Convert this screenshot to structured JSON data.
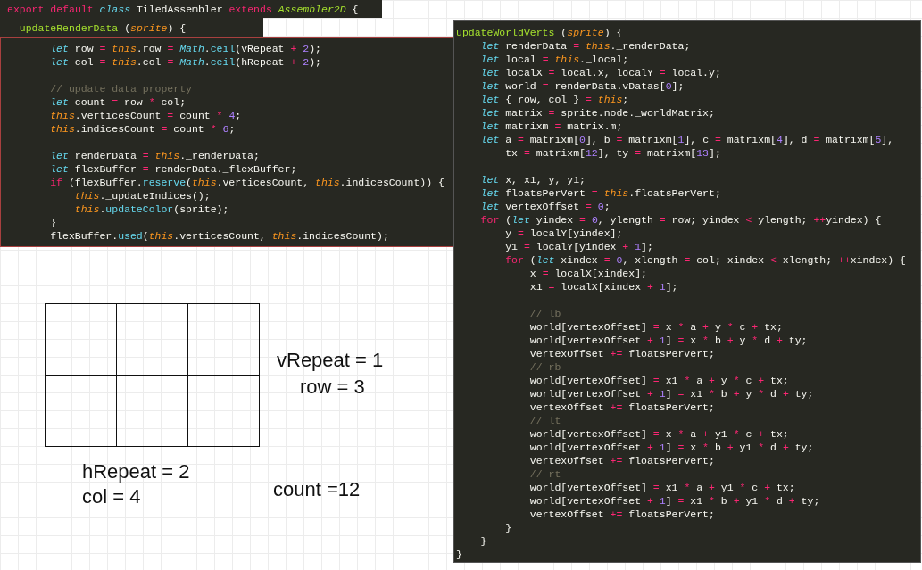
{
  "left_editor": {
    "class_line": [
      {
        "kind": "kw",
        "text": "export default "
      },
      {
        "kind": "st",
        "text": "class"
      },
      " TiledAssembler ",
      {
        "kind": "kw",
        "text": "extends "
      },
      {
        "kind": "ty",
        "text": "Assembler2D"
      },
      " {"
    ],
    "method_line": [
      {
        "kind": "fn",
        "text": "  updateRenderData"
      },
      " (",
      {
        "kind": "th",
        "text": "sprite"
      },
      ") {"
    ],
    "blocks": [
      [
        [
          {
            "kind": "st",
            "text": "        let"
          },
          " row ",
          {
            "kind": "op",
            "text": "= "
          },
          {
            "kind": "th",
            "text": "this"
          },
          ".row ",
          {
            "kind": "op",
            "text": "= "
          },
          {
            "kind": "st",
            "text": "Math"
          },
          ".",
          {
            "kind": "sp",
            "text": "ceil"
          },
          "(vRepeat ",
          {
            "kind": "op",
            "text": "+ "
          },
          {
            "kind": "nu",
            "text": "2"
          },
          ");"
        ],
        [
          {
            "kind": "st",
            "text": "        let"
          },
          " col ",
          {
            "kind": "op",
            "text": "= "
          },
          {
            "kind": "th",
            "text": "this"
          },
          ".col ",
          {
            "kind": "op",
            "text": "= "
          },
          {
            "kind": "st",
            "text": "Math"
          },
          ".",
          {
            "kind": "sp",
            "text": "ceil"
          },
          "(hRepeat ",
          {
            "kind": "op",
            "text": "+ "
          },
          {
            "kind": "nu",
            "text": "2"
          },
          ");"
        ]
      ],
      [
        [
          {
            "kind": "cm",
            "text": "        // update data property"
          }
        ],
        [
          {
            "kind": "st",
            "text": "        let"
          },
          " count ",
          {
            "kind": "op",
            "text": "= "
          },
          "row ",
          {
            "kind": "op",
            "text": "* "
          },
          "col;"
        ],
        [
          {
            "kind": "th",
            "text": "        this"
          },
          ".verticesCount ",
          {
            "kind": "op",
            "text": "= "
          },
          "count ",
          {
            "kind": "op",
            "text": "* "
          },
          {
            "kind": "nu",
            "text": "4"
          },
          ";"
        ],
        [
          {
            "kind": "th",
            "text": "        this"
          },
          ".indicesCount ",
          {
            "kind": "op",
            "text": "= "
          },
          "count ",
          {
            "kind": "op",
            "text": "* "
          },
          {
            "kind": "nu",
            "text": "6"
          },
          ";"
        ]
      ],
      [
        [
          {
            "kind": "st",
            "text": "        let"
          },
          " renderData ",
          {
            "kind": "op",
            "text": "= "
          },
          {
            "kind": "th",
            "text": "this"
          },
          "._renderData;"
        ],
        [
          {
            "kind": "st",
            "text": "        let"
          },
          " flexBuffer ",
          {
            "kind": "op",
            "text": "= "
          },
          "renderData._flexBuffer;"
        ],
        [
          {
            "kind": "kw",
            "text": "        if"
          },
          " (flexBuffer.",
          {
            "kind": "sp",
            "text": "reserve"
          },
          "(",
          {
            "kind": "th",
            "text": "this"
          },
          ".verticesCount, ",
          {
            "kind": "th",
            "text": "this"
          },
          ".indicesCount)) {"
        ],
        [
          {
            "kind": "th",
            "text": "            this"
          },
          "._updateIndices();"
        ],
        [
          {
            "kind": "th",
            "text": "            this"
          },
          ".",
          {
            "kind": "sp",
            "text": "updateColor"
          },
          "(sprite);"
        ],
        [
          "        }"
        ],
        [
          "        flexBuffer.",
          {
            "kind": "sp",
            "text": "used"
          },
          "(",
          {
            "kind": "th",
            "text": "this"
          },
          ".verticesCount, ",
          {
            "kind": "th",
            "text": "this"
          },
          ".indicesCount);"
        ]
      ]
    ]
  },
  "right_editor": {
    "blocks": [
      [
        [
          {
            "kind": "fn",
            "text": "updateWorldVerts"
          },
          " (",
          {
            "kind": "th",
            "text": "sprite"
          },
          ") {"
        ],
        [
          {
            "kind": "st",
            "text": "    let"
          },
          " renderData ",
          {
            "kind": "op",
            "text": "= "
          },
          {
            "kind": "th",
            "text": "this"
          },
          "._renderData;"
        ],
        [
          {
            "kind": "st",
            "text": "    let"
          },
          " local ",
          {
            "kind": "op",
            "text": "= "
          },
          {
            "kind": "th",
            "text": "this"
          },
          "._local;"
        ],
        [
          {
            "kind": "st",
            "text": "    let"
          },
          " localX ",
          {
            "kind": "op",
            "text": "= "
          },
          "local.x, localY ",
          {
            "kind": "op",
            "text": "= "
          },
          "local.y;"
        ],
        [
          {
            "kind": "st",
            "text": "    let"
          },
          " world ",
          {
            "kind": "op",
            "text": "= "
          },
          "renderData.vDatas[",
          {
            "kind": "nu",
            "text": "0"
          },
          "];"
        ],
        [
          {
            "kind": "st",
            "text": "    let"
          },
          " { row, col } ",
          {
            "kind": "op",
            "text": "= "
          },
          {
            "kind": "th",
            "text": "this"
          },
          ";"
        ],
        [
          {
            "kind": "st",
            "text": "    let"
          },
          " matrix ",
          {
            "kind": "op",
            "text": "= "
          },
          "sprite.node._worldMatrix;"
        ],
        [
          {
            "kind": "st",
            "text": "    let"
          },
          " matrixm ",
          {
            "kind": "op",
            "text": "= "
          },
          "matrix.m;"
        ],
        [
          {
            "kind": "st",
            "text": "    let"
          },
          " a ",
          {
            "kind": "op",
            "text": "= "
          },
          "matrixm[",
          {
            "kind": "nu",
            "text": "0"
          },
          "], b ",
          {
            "kind": "op",
            "text": "= "
          },
          "matrixm[",
          {
            "kind": "nu",
            "text": "1"
          },
          "], c ",
          {
            "kind": "op",
            "text": "= "
          },
          "matrixm[",
          {
            "kind": "nu",
            "text": "4"
          },
          "], d ",
          {
            "kind": "op",
            "text": "= "
          },
          "matrixm[",
          {
            "kind": "nu",
            "text": "5"
          },
          "],"
        ],
        [
          "        tx ",
          {
            "kind": "op",
            "text": "= "
          },
          "matrixm[",
          {
            "kind": "nu",
            "text": "12"
          },
          "], ty ",
          {
            "kind": "op",
            "text": "= "
          },
          "matrixm[",
          {
            "kind": "nu",
            "text": "13"
          },
          "];"
        ]
      ],
      [
        [
          {
            "kind": "st",
            "text": "    let"
          },
          " x, x1, y, y1;"
        ],
        [
          {
            "kind": "st",
            "text": "    let"
          },
          " floatsPerVert ",
          {
            "kind": "op",
            "text": "= "
          },
          {
            "kind": "th",
            "text": "this"
          },
          ".floatsPerVert;"
        ],
        [
          {
            "kind": "st",
            "text": "    let"
          },
          " vertexOffset ",
          {
            "kind": "op",
            "text": "= "
          },
          {
            "kind": "nu",
            "text": "0"
          },
          ";"
        ],
        [
          {
            "kind": "kw",
            "text": "    for"
          },
          " (",
          {
            "kind": "st",
            "text": "let"
          },
          " yindex ",
          {
            "kind": "op",
            "text": "= "
          },
          {
            "kind": "nu",
            "text": "0"
          },
          ", ylength ",
          {
            "kind": "op",
            "text": "= "
          },
          "row; yindex ",
          {
            "kind": "op",
            "text": "< "
          },
          "ylength; ",
          {
            "kind": "op",
            "text": "++"
          },
          "yindex) {"
        ],
        [
          "        y ",
          {
            "kind": "op",
            "text": "= "
          },
          "localY[yindex];"
        ],
        [
          "        y1 ",
          {
            "kind": "op",
            "text": "= "
          },
          "localY[yindex ",
          {
            "kind": "op",
            "text": "+ "
          },
          {
            "kind": "nu",
            "text": "1"
          },
          "];"
        ],
        [
          {
            "kind": "kw",
            "text": "        for"
          },
          " (",
          {
            "kind": "st",
            "text": "let"
          },
          " xindex ",
          {
            "kind": "op",
            "text": "= "
          },
          {
            "kind": "nu",
            "text": "0"
          },
          ", xlength ",
          {
            "kind": "op",
            "text": "= "
          },
          "col; xindex ",
          {
            "kind": "op",
            "text": "< "
          },
          "xlength; ",
          {
            "kind": "op",
            "text": "++"
          },
          "xindex) {"
        ],
        [
          "            x ",
          {
            "kind": "op",
            "text": "= "
          },
          "localX[xindex];"
        ],
        [
          "            x1 ",
          {
            "kind": "op",
            "text": "= "
          },
          "localX[xindex ",
          {
            "kind": "op",
            "text": "+ "
          },
          {
            "kind": "nu",
            "text": "1"
          },
          "];"
        ]
      ],
      [
        [
          {
            "kind": "cm",
            "text": "            // lb"
          }
        ],
        [
          "            world[vertexOffset] ",
          {
            "kind": "op",
            "text": "= "
          },
          "x ",
          {
            "kind": "op",
            "text": "* "
          },
          "a ",
          {
            "kind": "op",
            "text": "+ "
          },
          "y ",
          {
            "kind": "op",
            "text": "* "
          },
          "c ",
          {
            "kind": "op",
            "text": "+ "
          },
          "tx;"
        ],
        [
          "            world[vertexOffset ",
          {
            "kind": "op",
            "text": "+ "
          },
          {
            "kind": "nu",
            "text": "1"
          },
          "] ",
          {
            "kind": "op",
            "text": "= "
          },
          "x ",
          {
            "kind": "op",
            "text": "* "
          },
          "b ",
          {
            "kind": "op",
            "text": "+ "
          },
          "y ",
          {
            "kind": "op",
            "text": "* "
          },
          "d ",
          {
            "kind": "op",
            "text": "+ "
          },
          "ty;"
        ],
        [
          "            vertexOffset ",
          {
            "kind": "op",
            "text": "+= "
          },
          "floatsPerVert;"
        ],
        [
          {
            "kind": "cm",
            "text": "            // rb"
          }
        ],
        [
          "            world[vertexOffset] ",
          {
            "kind": "op",
            "text": "= "
          },
          "x1 ",
          {
            "kind": "op",
            "text": "* "
          },
          "a ",
          {
            "kind": "op",
            "text": "+ "
          },
          "y ",
          {
            "kind": "op",
            "text": "* "
          },
          "c ",
          {
            "kind": "op",
            "text": "+ "
          },
          "tx;"
        ],
        [
          "            world[vertexOffset ",
          {
            "kind": "op",
            "text": "+ "
          },
          {
            "kind": "nu",
            "text": "1"
          },
          "] ",
          {
            "kind": "op",
            "text": "= "
          },
          "x1 ",
          {
            "kind": "op",
            "text": "* "
          },
          "b ",
          {
            "kind": "op",
            "text": "+ "
          },
          "y ",
          {
            "kind": "op",
            "text": "* "
          },
          "d ",
          {
            "kind": "op",
            "text": "+ "
          },
          "ty;"
        ],
        [
          "            vertexOffset ",
          {
            "kind": "op",
            "text": "+= "
          },
          "floatsPerVert;"
        ],
        [
          {
            "kind": "cm",
            "text": "            // lt"
          }
        ],
        [
          "            world[vertexOffset] ",
          {
            "kind": "op",
            "text": "= "
          },
          "x ",
          {
            "kind": "op",
            "text": "* "
          },
          "a ",
          {
            "kind": "op",
            "text": "+ "
          },
          "y1 ",
          {
            "kind": "op",
            "text": "* "
          },
          "c ",
          {
            "kind": "op",
            "text": "+ "
          },
          "tx;"
        ],
        [
          "            world[vertexOffset ",
          {
            "kind": "op",
            "text": "+ "
          },
          {
            "kind": "nu",
            "text": "1"
          },
          "] ",
          {
            "kind": "op",
            "text": "= "
          },
          "x ",
          {
            "kind": "op",
            "text": "* "
          },
          "b ",
          {
            "kind": "op",
            "text": "+ "
          },
          "y1 ",
          {
            "kind": "op",
            "text": "* "
          },
          "d ",
          {
            "kind": "op",
            "text": "+ "
          },
          "ty;"
        ],
        [
          "            vertexOffset ",
          {
            "kind": "op",
            "text": "+= "
          },
          "floatsPerVert;"
        ],
        [
          {
            "kind": "cm",
            "text": "            // rt"
          }
        ],
        [
          "            world[vertexOffset] ",
          {
            "kind": "op",
            "text": "= "
          },
          "x1 ",
          {
            "kind": "op",
            "text": "* "
          },
          "a ",
          {
            "kind": "op",
            "text": "+ "
          },
          "y1 ",
          {
            "kind": "op",
            "text": "* "
          },
          "c ",
          {
            "kind": "op",
            "text": "+ "
          },
          "tx;"
        ],
        [
          "            world[vertexOffset ",
          {
            "kind": "op",
            "text": "+ "
          },
          {
            "kind": "nu",
            "text": "1"
          },
          "] ",
          {
            "kind": "op",
            "text": "= "
          },
          "x1 ",
          {
            "kind": "op",
            "text": "* "
          },
          "b ",
          {
            "kind": "op",
            "text": "+ "
          },
          "y1 ",
          {
            "kind": "op",
            "text": "* "
          },
          "d ",
          {
            "kind": "op",
            "text": "+ "
          },
          "ty;"
        ],
        [
          "            vertexOffset ",
          {
            "kind": "op",
            "text": "+= "
          },
          "floatsPerVert;"
        ],
        [
          "        }"
        ],
        [
          "    }"
        ],
        [
          "}"
        ]
      ]
    ]
  },
  "diagram": {
    "labels": [
      "vRepeat = 1",
      "row = 3",
      "hRepeat = 2",
      "col = 4",
      "count =12"
    ]
  }
}
